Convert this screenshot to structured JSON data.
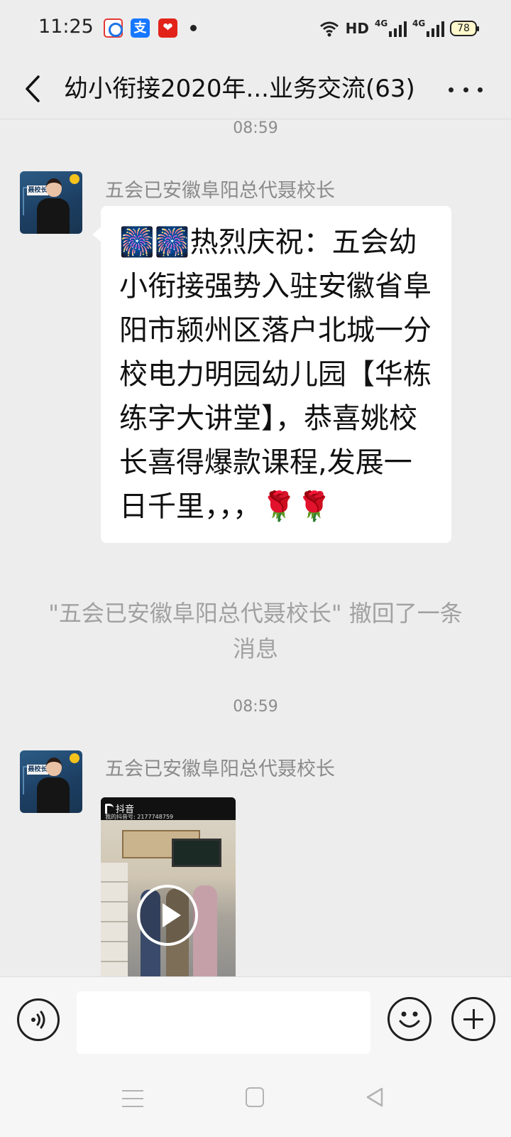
{
  "status_bar": {
    "time": "11:25",
    "notification_icons": [
      "browser-app-icon",
      "alipay-icon",
      "pinduoduo-icon"
    ],
    "network_label": "HD",
    "signal_1_label": "4G",
    "signal_2_label": "4G",
    "battery_level": "78"
  },
  "header": {
    "title": "幼小衔接2020年...业务交流(63)"
  },
  "messages": [
    {
      "time": "08:59",
      "sender": "五会已安徽阜阳总代聂校长",
      "avatar_caption": "聂校长",
      "text": "🎆🎆热烈庆祝：五会幼小衔接强势入驻安徽省阜阳市颍州区落户北城一分校电力明园幼儿园【华栋练字大讲堂】，恭喜姚校长喜得爆款课程,发展一日千里，，，🌹🌹"
    },
    {
      "system_notice": "\"五会已安徽阜阳总代聂校长\" 撤回了一条消息"
    },
    {
      "time": "08:59",
      "sender": "五会已安徽阜阳总代聂校长",
      "video": {
        "platform_label": "抖音",
        "account_text": "我的抖音号: 2177748759"
      }
    }
  ],
  "input_bar": {
    "placeholder": ""
  },
  "colors": {
    "chat_background": "#ededed",
    "bubble_background": "#ffffff",
    "secondary_text": "#8a8a8a"
  }
}
